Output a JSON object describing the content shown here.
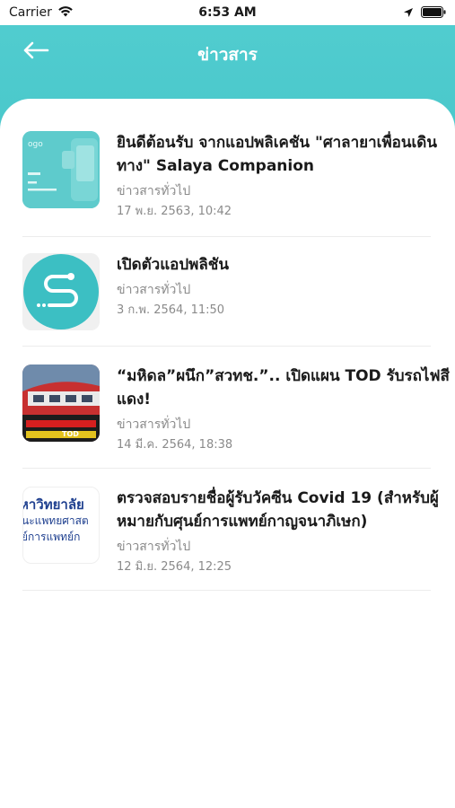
{
  "status": {
    "carrier": "Carrier",
    "time": "6:53 AM"
  },
  "nav": {
    "title": "ข่าวสาร"
  },
  "news": [
    {
      "title_lines": [
        "ยินดีต้อนรับ จากแอปพลิเคชัน \"ศาลายาเพื่อนเดิน",
        "ทาง\" Salaya Companion"
      ],
      "category": "ข่าวสารทั่วไป",
      "date": "17 พ.ย. 2563, 10:42",
      "thumb_text": "ogo"
    },
    {
      "title_lines": [
        "เปิดตัวแอปพลิชัน"
      ],
      "category": "ข่าวสารทั่วไป",
      "date": "3 ก.พ. 2564, 11:50",
      "thumb_text": ""
    },
    {
      "title_lines": [
        "“มหิดล”ผนึก”สวทช.”.. เปิดแผน TOD รับรถไฟสี",
        "แดง!"
      ],
      "category": "ข่าวสารทั่วไป",
      "date": "14 มี.ค. 2564, 18:38",
      "thumb_text": "TOD"
    },
    {
      "title_lines": [
        "ตรวจสอบรายชื่อผู้รับวัคซีน Covid 19 (สำหรับผู้",
        "หมายกับศุนย์การแพทย์กาญจนาภิเษก)"
      ],
      "category": "ข่าวสารทั่วไป",
      "date": "12 มิ.ย. 2564, 12:25",
      "thumb_text_lines": [
        "หาวิทยาลัย",
        "นะแพทยศาสต",
        "ย์การแพทย์ก"
      ]
    }
  ]
}
